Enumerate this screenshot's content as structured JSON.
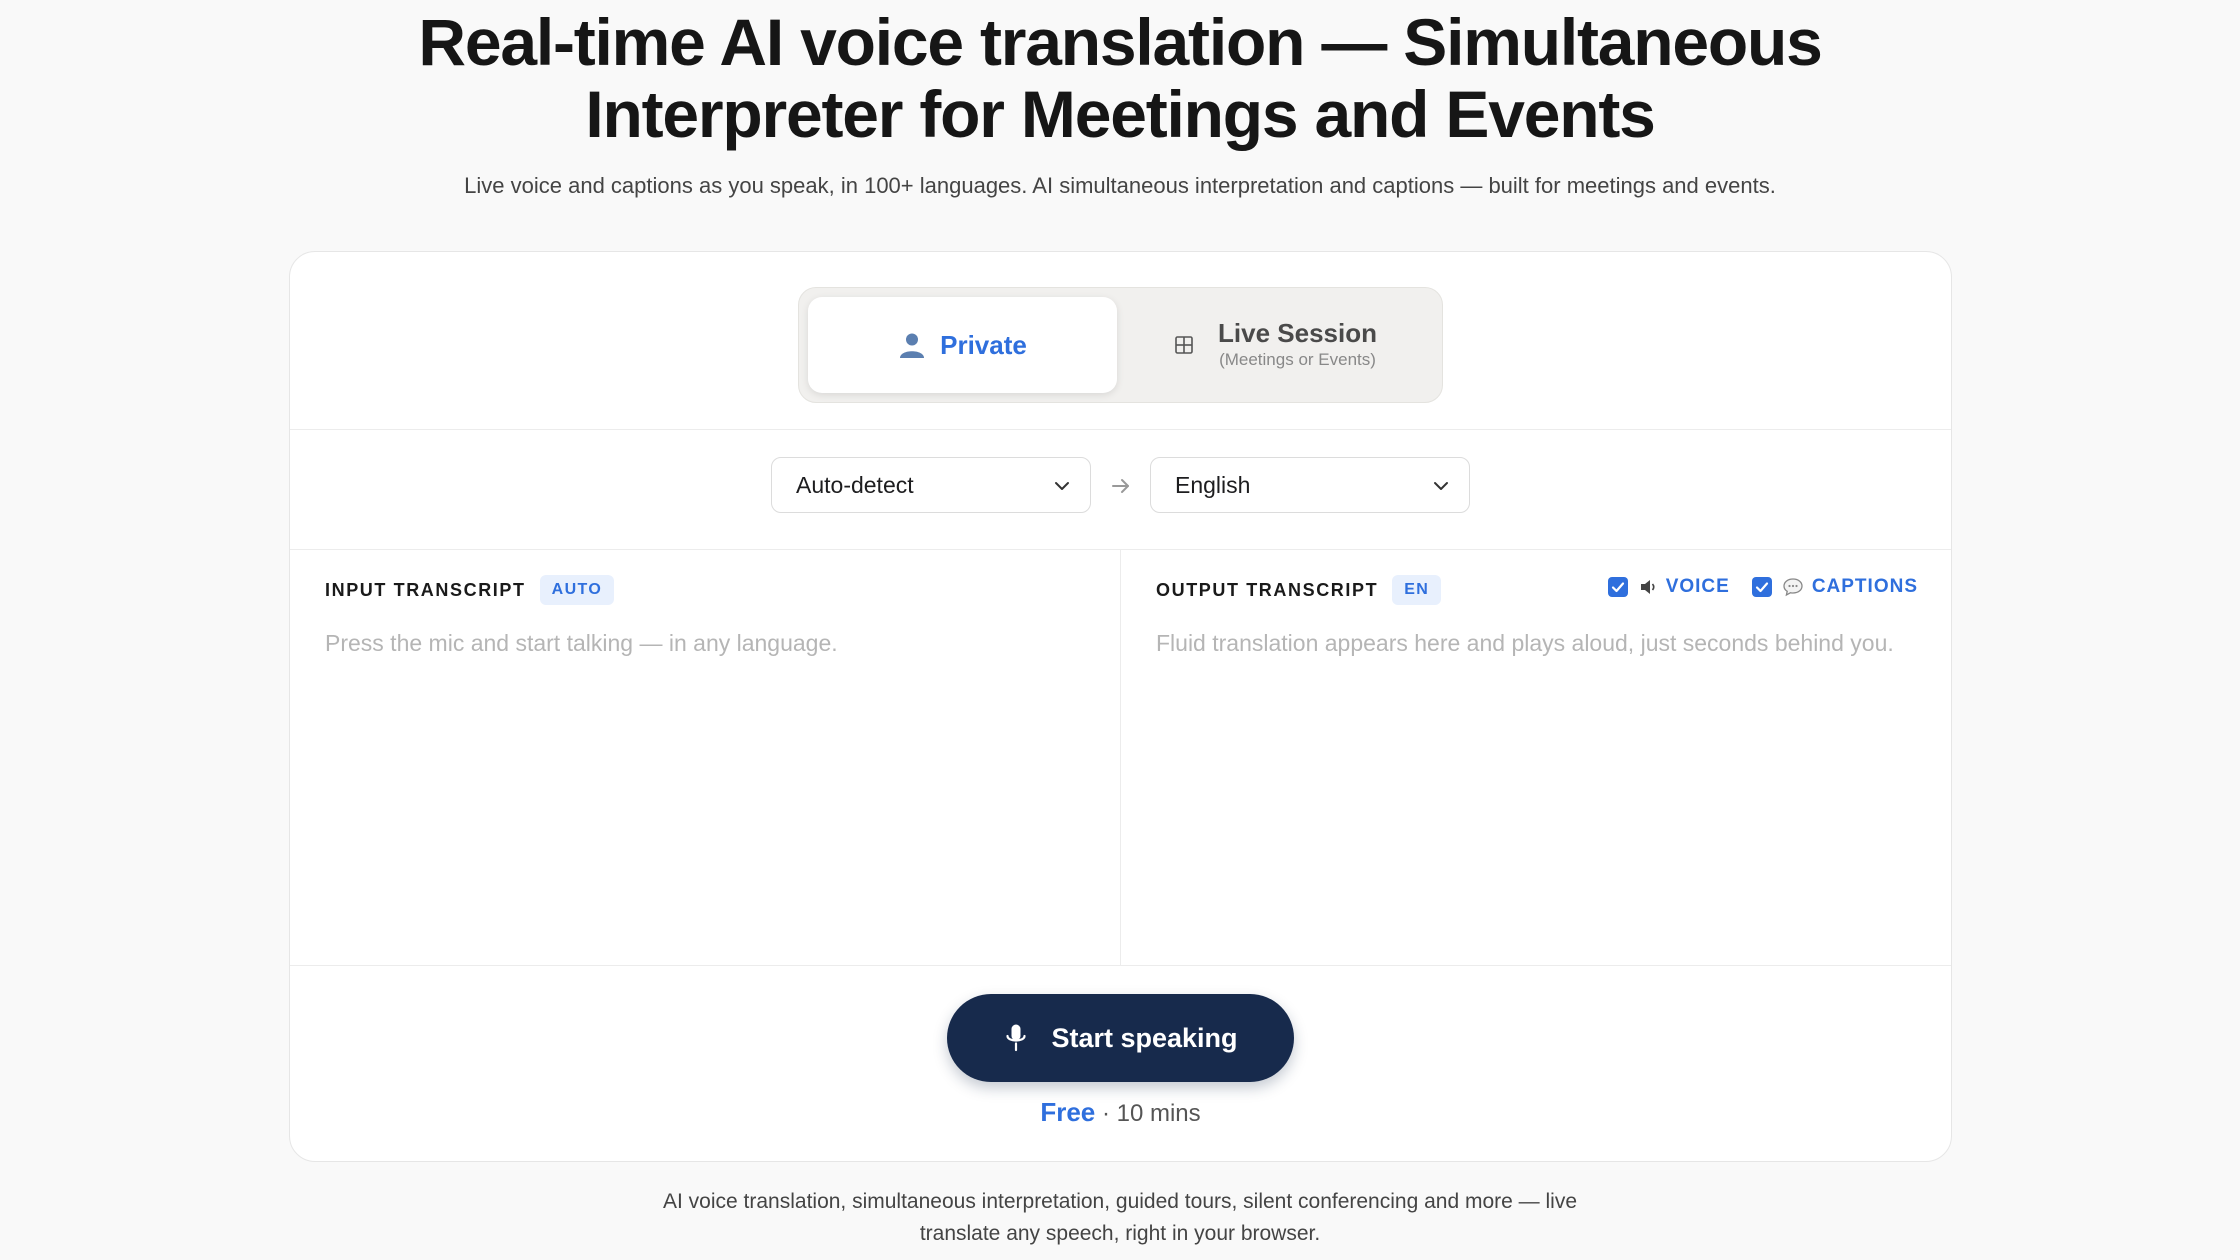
{
  "hero": {
    "title_line1": "Real-time AI voice translation — Simultaneous",
    "title_line2": "Interpreter for Meetings and Events",
    "subtitle": "Live voice and captions as you speak, in 100+ languages. AI simultaneous interpretation and captions — built for meetings and events."
  },
  "mode": {
    "private_label": "Private",
    "live_title": "Live Session",
    "live_subtitle": "(Meetings or Events)",
    "selected": "Private"
  },
  "languages": {
    "source": "Auto-detect",
    "target": "English"
  },
  "input": {
    "title": "INPUT TRANSCRIPT",
    "badge": "AUTO",
    "placeholder": "Press the mic and start talking — in any language."
  },
  "output": {
    "title": "OUTPUT TRANSCRIPT",
    "badge": "EN",
    "placeholder": "Fluid translation appears here and plays aloud, just seconds behind you.",
    "voice_label": "VOICE",
    "captions_label": "CAPTIONS",
    "voice_checked": true,
    "captions_checked": true
  },
  "action": {
    "start_label": "Start speaking",
    "free_label": "Free",
    "duration": "· 10 mins"
  },
  "footer": {
    "line1": "AI voice translation, simultaneous interpretation, guided tours, silent conferencing and more — live",
    "line2": "translate any speech, right in your browser."
  },
  "colors": {
    "accent": "#2f6fdd",
    "primary_button": "#172a4c",
    "badge_bg": "#e8f0fd"
  }
}
